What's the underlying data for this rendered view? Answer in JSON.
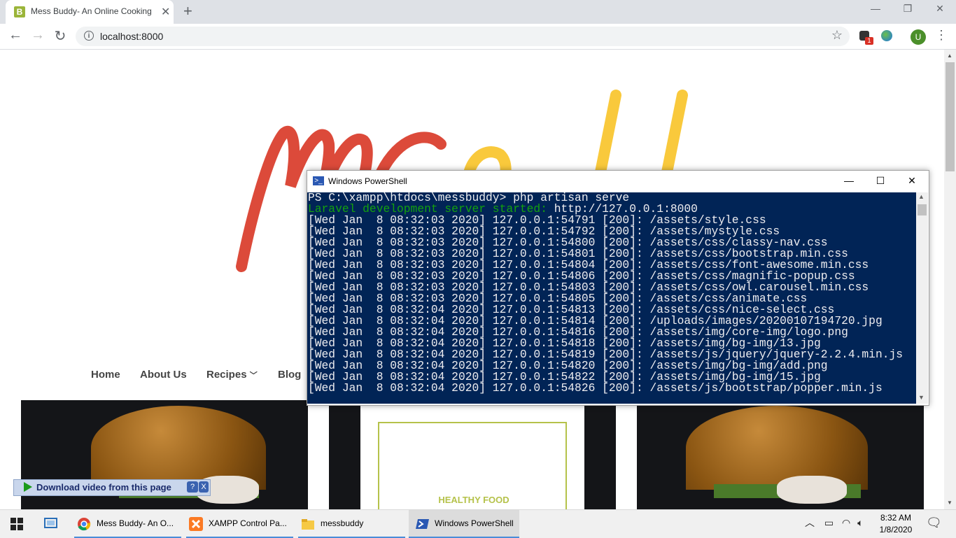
{
  "browser": {
    "tab_title": "Mess Buddy- An Online Cooking",
    "tab_favicon_letter": "B",
    "url": "localhost:8000",
    "profile_initial": "U",
    "extension_badge": "1"
  },
  "site": {
    "nav": [
      "Home",
      "About Us",
      "Recipes",
      "Blog"
    ],
    "card_label": "HEALTHY FOOD",
    "accent_color": "#b5c24a"
  },
  "download_bar": {
    "label": "Download video from this page",
    "help": "?",
    "close": "X"
  },
  "powershell": {
    "title": "Windows PowerShell",
    "lines": [
      "PS C:\\xampp\\htdocs\\messbuddy> php artisan serve",
      "Laravel development server started: http://127.0.0.1:8000",
      "[Wed Jan  8 08:32:03 2020] 127.0.0.1:54791 [200]: /assets/style.css",
      "[Wed Jan  8 08:32:03 2020] 127.0.0.1:54792 [200]: /assets/mystyle.css",
      "[Wed Jan  8 08:32:03 2020] 127.0.0.1:54800 [200]: /assets/css/classy-nav.css",
      "[Wed Jan  8 08:32:03 2020] 127.0.0.1:54801 [200]: /assets/css/bootstrap.min.css",
      "[Wed Jan  8 08:32:03 2020] 127.0.0.1:54804 [200]: /assets/css/font-awesome.min.css",
      "[Wed Jan  8 08:32:03 2020] 127.0.0.1:54806 [200]: /assets/css/magnific-popup.css",
      "[Wed Jan  8 08:32:03 2020] 127.0.0.1:54803 [200]: /assets/css/owl.carousel.min.css",
      "[Wed Jan  8 08:32:03 2020] 127.0.0.1:54805 [200]: /assets/css/animate.css",
      "[Wed Jan  8 08:32:04 2020] 127.0.0.1:54813 [200]: /assets/css/nice-select.css",
      "[Wed Jan  8 08:32:04 2020] 127.0.0.1:54814 [200]: /uploads/images/20200107194720.jpg",
      "[Wed Jan  8 08:32:04 2020] 127.0.0.1:54816 [200]: /assets/img/core-img/logo.png",
      "[Wed Jan  8 08:32:04 2020] 127.0.0.1:54818 [200]: /assets/img/bg-img/13.jpg",
      "[Wed Jan  8 08:32:04 2020] 127.0.0.1:54819 [200]: /assets/js/jquery/jquery-2.2.4.min.js",
      "[Wed Jan  8 08:32:04 2020] 127.0.0.1:54820 [200]: /assets/img/bg-img/add.png",
      "[Wed Jan  8 08:32:04 2020] 127.0.0.1:54822 [200]: /assets/img/bg-img/15.jpg",
      "[Wed Jan  8 08:32:04 2020] 127.0.0.1:54826 [200]: /assets/js/bootstrap/popper.min.js"
    ],
    "green_prefix": "Laravel development server started:"
  },
  "taskbar": {
    "items": [
      "Mess Buddy- An O...",
      "XAMPP Control Pa...",
      "messbuddy",
      "Windows PowerShell"
    ],
    "time": "8:32 AM",
    "date": "1/8/2020"
  }
}
